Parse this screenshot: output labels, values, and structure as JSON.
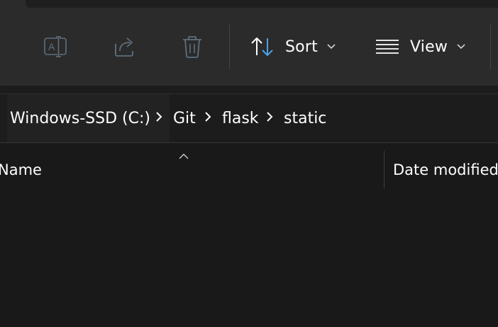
{
  "toolbar": {
    "rename_icon": "rename-icon",
    "share_icon": "share-icon",
    "delete_icon": "trash-icon",
    "sort_label": "Sort",
    "view_label": "View"
  },
  "breadcrumb": {
    "items": [
      "Windows-SSD (C:)",
      "Git",
      "flask",
      "static"
    ]
  },
  "columns": {
    "name": "Name",
    "date_modified": "Date modified"
  },
  "colors": {
    "toolbar_bg": "#2b2b2b",
    "content_bg": "#191919",
    "accent": "#4aa3e8"
  }
}
